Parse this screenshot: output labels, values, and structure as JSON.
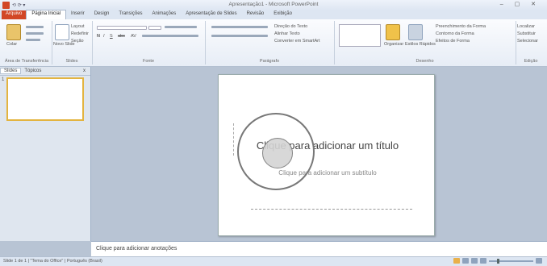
{
  "window": {
    "title": "Apresentação1 - Microsoft PowerPoint",
    "controls": "–  ▢  ✕"
  },
  "qat": {
    "label": "⟲ ⟳ ▾"
  },
  "tabs": {
    "file": "Arquivo",
    "items": [
      "Página Inicial",
      "Inserir",
      "Design",
      "Transições",
      "Animações",
      "Apresentação de Slides",
      "Revisão",
      "Exibição"
    ],
    "active_index": 0
  },
  "ribbon": {
    "groups": [
      {
        "label": "Área de Transferência",
        "buttons": [
          "Colar"
        ]
      },
      {
        "label": "Slides",
        "buttons": [
          "Novo Slide",
          "Layout",
          "Redefinir",
          "Seção"
        ]
      },
      {
        "label": "Fonte",
        "buttons": [
          "N",
          "I",
          "S",
          "abc",
          "AV"
        ]
      },
      {
        "label": "Parágrafo",
        "buttons": [
          "Direção do Texto",
          "Alinhar Texto",
          "Converter em SmartArt"
        ]
      },
      {
        "label": "Desenho",
        "buttons": [
          "Organizar",
          "Estilos Rápidos",
          "Preenchimento da Forma",
          "Contorno da Forma",
          "Efeitos de Forma"
        ]
      },
      {
        "label": "Edição",
        "buttons": [
          "Localizar",
          "Substituir",
          "Selecionar"
        ]
      }
    ]
  },
  "panel": {
    "tabs": [
      "Slides",
      "Tópicos"
    ],
    "close": "x",
    "thumbnail_number": "1"
  },
  "slide": {
    "title_placeholder": "Clique para adicionar um título",
    "subtitle_placeholder": "Clique para adicionar um subtítulo"
  },
  "notes": {
    "placeholder": "Clique para adicionar anotações"
  },
  "status": {
    "left": "Slide 1 de 1   |   \"Tema do Office\"   |   Português (Brasil)",
    "zoom_percent": 45
  }
}
